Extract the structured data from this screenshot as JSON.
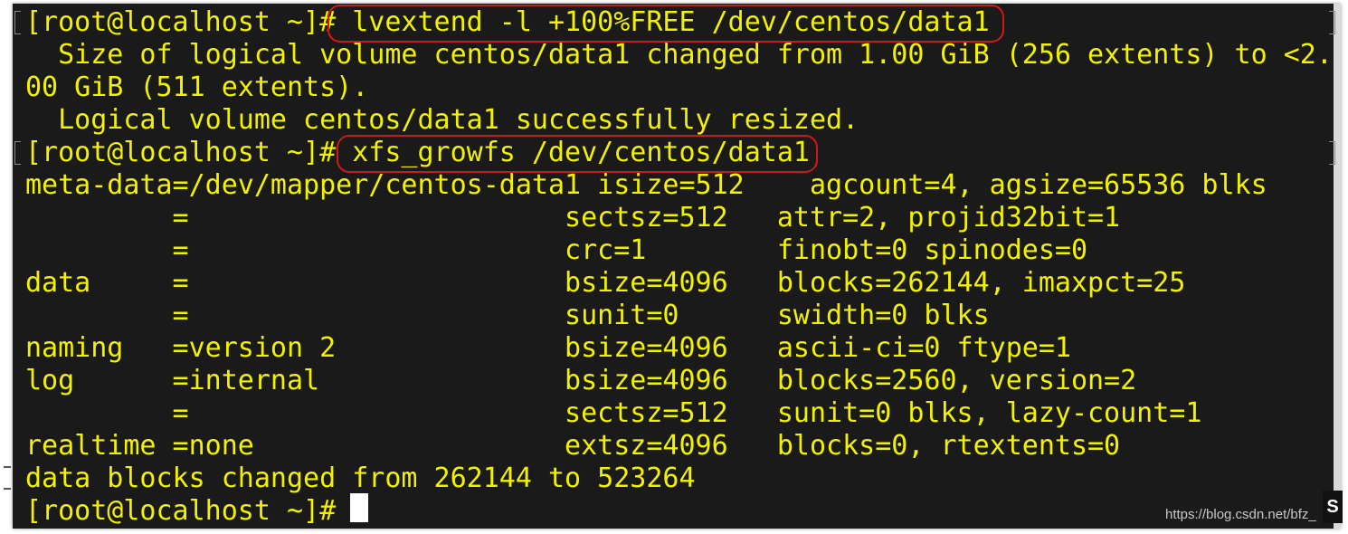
{
  "terminal": {
    "colors": {
      "background": "#1a1a1a",
      "text": "#f2f200",
      "highlight": "#d01818",
      "cursor": "#ffffff"
    },
    "lines": [
      "[root@localhost ~]# lvextend -l +100%FREE /dev/centos/data1",
      "  Size of logical volume centos/data1 changed from 1.00 GiB (256 extents) to <2.",
      "00 GiB (511 extents).",
      "  Logical volume centos/data1 successfully resized.",
      "[root@localhost ~]# xfs_growfs /dev/centos/data1",
      "meta-data=/dev/mapper/centos-data1 isize=512    agcount=4, agsize=65536 blks",
      "         =                       sectsz=512   attr=2, projid32bit=1",
      "         =                       crc=1        finobt=0 spinodes=0",
      "data     =                       bsize=4096   blocks=262144, imaxpct=25",
      "         =                       sunit=0      swidth=0 blks",
      "naming   =version 2              bsize=4096   ascii-ci=0 ftype=1",
      "log      =internal               bsize=4096   blocks=2560, version=2",
      "         =                       sectsz=512   sunit=0 blks, lazy-count=1",
      "realtime =none                   extsz=4096   blocks=0, rtextents=0",
      "data blocks changed from 262144 to 523264",
      "[root@localhost ~]# "
    ],
    "highlighted_commands": [
      "lvextend -l +100%FREE /dev/centos/data1",
      "xfs_growfs /dev/centos/data1"
    ]
  },
  "watermark": "https://blog.csdn.net/bfz_",
  "corner_badge": "S"
}
